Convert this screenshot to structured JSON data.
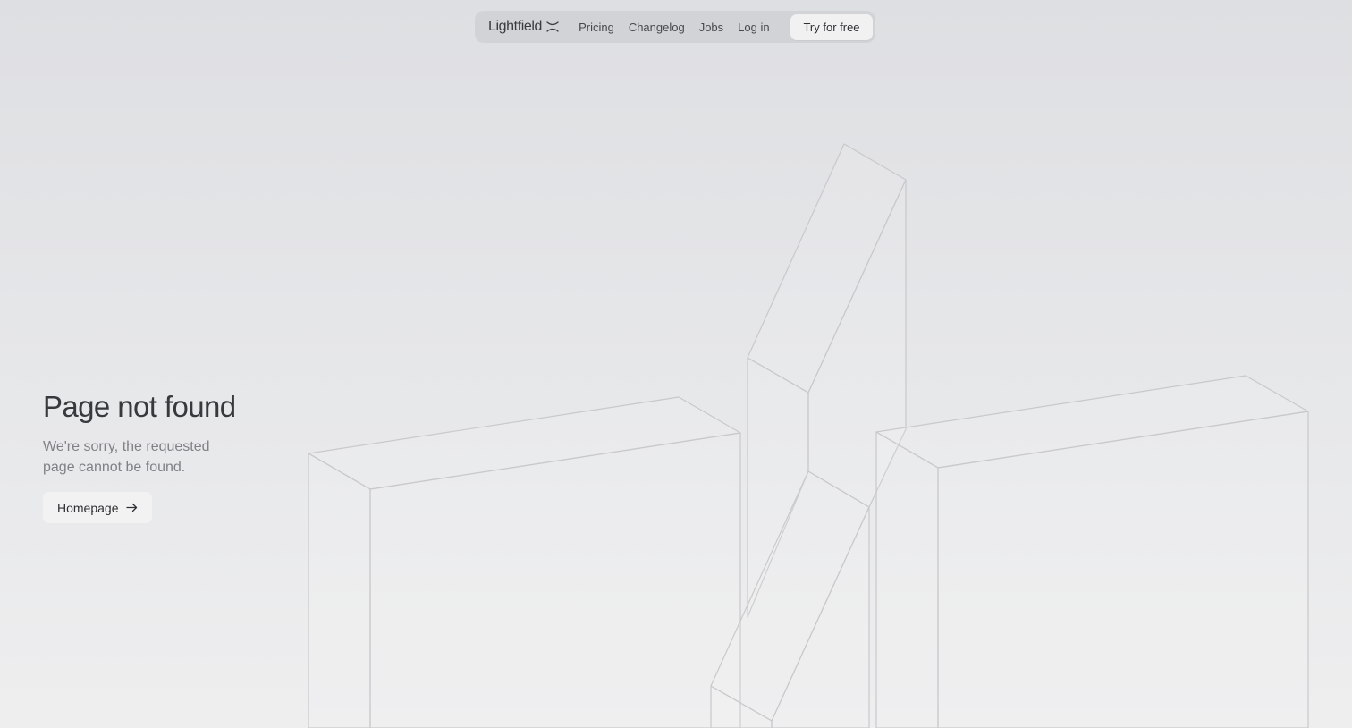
{
  "nav": {
    "logo_text": "Lightfield",
    "logo_icon": "crossed-arcs-icon",
    "links": [
      "Pricing",
      "Changelog",
      "Jobs",
      "Log in"
    ],
    "cta_label": "Try for free"
  },
  "main": {
    "title": "Page not found",
    "description": "We're sorry, the requested page cannot be found.",
    "home_button_label": "Homepage",
    "home_button_icon": "arrow-right-icon"
  },
  "colors": {
    "background_top": "#dedfe2",
    "background_bottom": "#eeeeef",
    "outline_stroke": "#c9c9cc",
    "text_primary": "#2f3033",
    "text_muted": "#808186"
  }
}
